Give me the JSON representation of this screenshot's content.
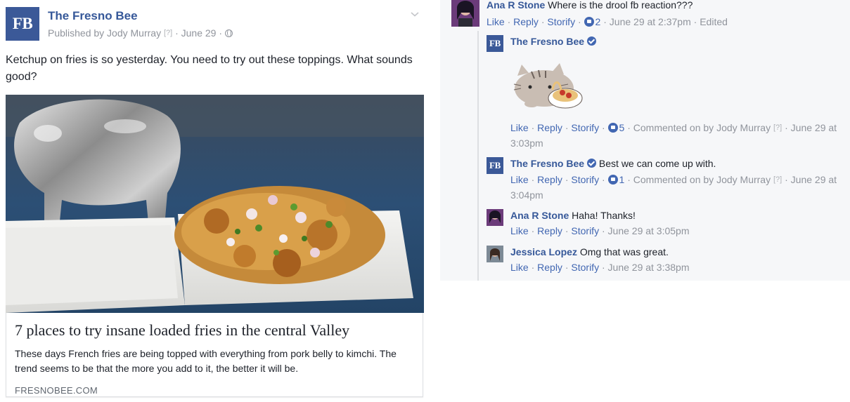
{
  "post": {
    "page_name": "The Fresno Bee",
    "logo_text": "FB",
    "published_by": "Published by Jody Murray",
    "help_marker": "[?]",
    "date": "· June 29 ·",
    "text": "Ketchup on fries is so yesterday. You need to try out these toppings. What sounds good?",
    "link": {
      "title": "7 places to try insane loaded fries in the central Valley",
      "description": "These days French fries are being topped with everything from pork belly to kimchi. The trend seems to be that the more you add to it, the better it will be.",
      "domain": "FRESNOBEE.COM"
    }
  },
  "actions": {
    "like": "Like",
    "reply": "Reply",
    "storify": "Storify",
    "sep": "·"
  },
  "comments": [
    {
      "author": "Ana R Stone",
      "text": "Where is the drool fb reaction???",
      "likes": "2",
      "time": "June 29 at 2:37pm",
      "edited": "· Edited"
    },
    {
      "author": "The Fresno Bee",
      "logo_text": "FB",
      "sticker": "pusheen-spaghetti-sticker",
      "likes": "5",
      "meta_prefix": "Commented on by Jody Murray",
      "help_marker": "[?]",
      "meta_suffix": "· June",
      "time": "29 at 3:03pm"
    },
    {
      "author": "The Fresno Bee",
      "logo_text": "FB",
      "text": "Best we can come up with.",
      "likes": "1",
      "meta_prefix": "Commented on by Jody Murray",
      "help_marker": "[?]",
      "meta_suffix": "· June",
      "time": "29 at 3:04pm"
    },
    {
      "author": "Ana R Stone",
      "text": "Haha! Thanks!",
      "time": "June 29 at 3:05pm"
    },
    {
      "author": "Jessica Lopez",
      "text": "Omg that was great.",
      "time": "June 29 at 3:38pm"
    }
  ],
  "colors": {
    "brand": "#3b5998",
    "link": "#365899",
    "accent": "#4267b2",
    "muted": "#90949c"
  }
}
